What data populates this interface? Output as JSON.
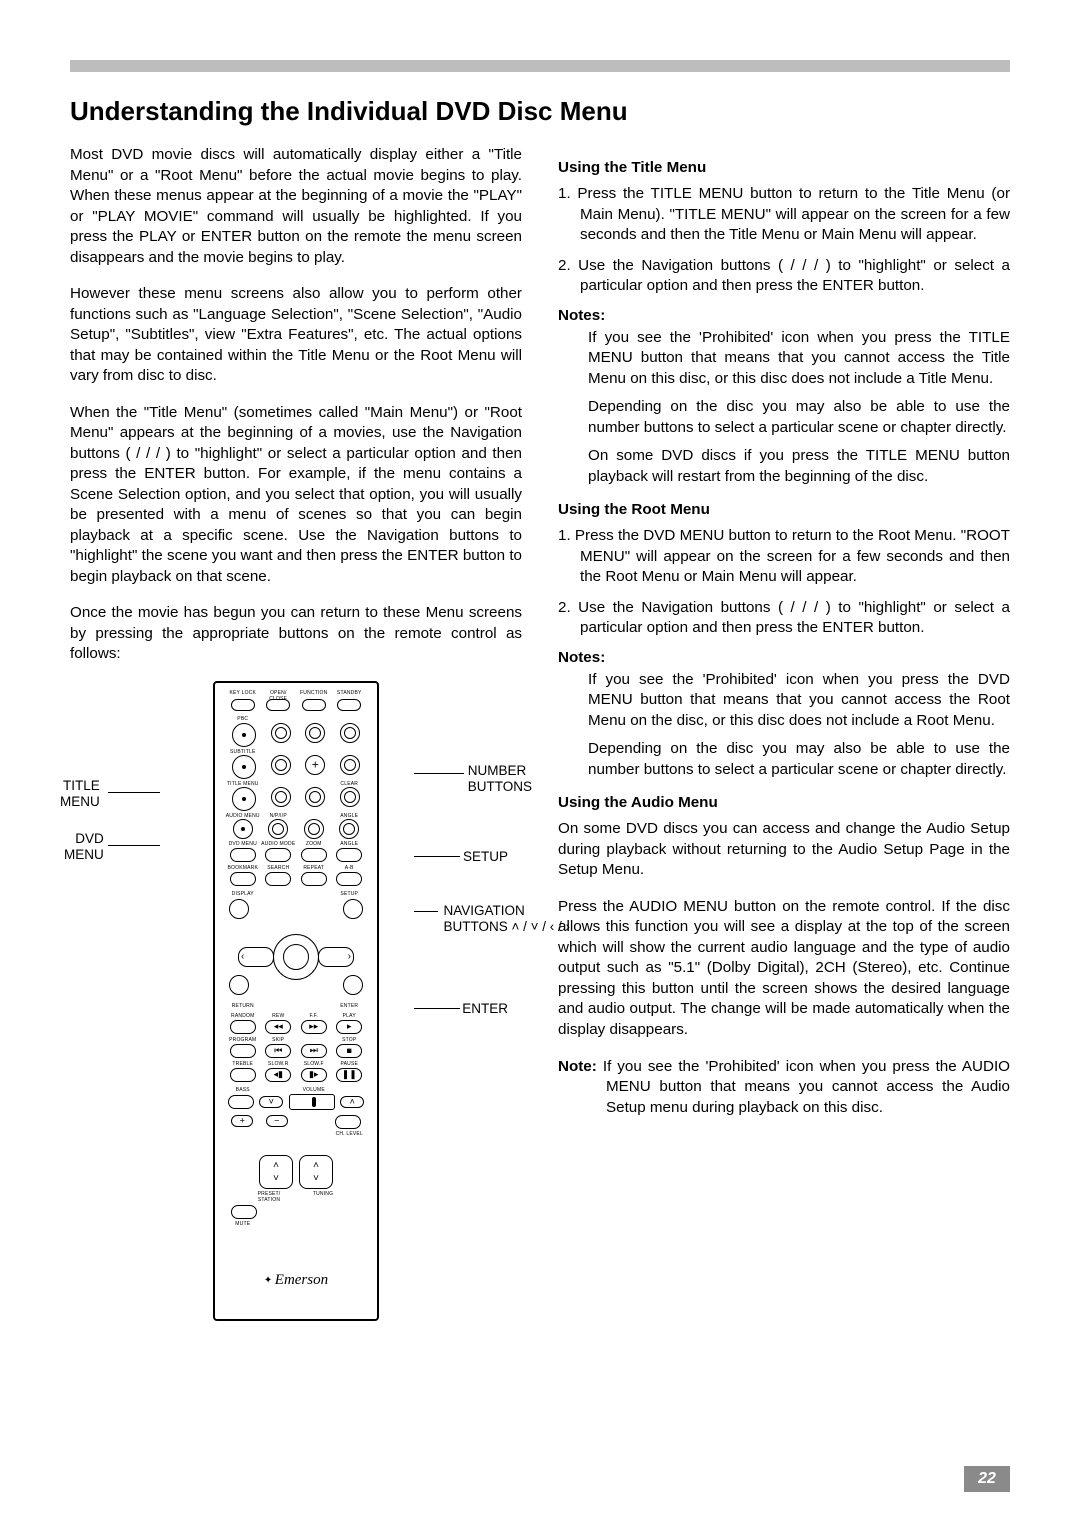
{
  "page_number": "22",
  "title": "Understanding the Individual DVD Disc Menu",
  "left_paras": [
    "Most DVD movie discs will automatically display either a \"Title Menu\" or a \"Root Menu\" before the actual movie begins to play. When these menus appear at the beginning of a movie the \"PLAY\" or \"PLAY MOVIE\" command will usually be highlighted. If you press the PLAY or ENTER button on the remote the menu screen disappears and the movie begins to play.",
    "However these menu screens also allow you to perform other functions such as \"Language Selection\", \"Scene Selection\", \"Audio Setup\", \"Subtitles\", view \"Extra Features\", etc. The actual options that may be contained within the Title Menu or the Root Menu will vary from disc to disc.",
    "When the \"Title Menu\" (sometimes called \"Main Menu\") or \"Root Menu\" appears at the beginning of a movies, use the Navigation buttons (    /    /    /    ) to \"highlight\" or select a particular option and then press the ENTER button. For example, if the menu contains a Scene Selection option, and you select that option, you will usually be presented with a menu of scenes so that you can begin playback at a specific scene. Use the Navigation buttons to \"highlight\" the scene you want and then press the ENTER button to begin playback on that scene.",
    "Once the movie has begun you can return to these Menu screens by pressing the appropriate buttons on the remote control as follows:"
  ],
  "sections": [
    {
      "heading": "Using the Title Menu",
      "items": [
        "1. Press the TITLE MENU button to return to the Title Menu (or Main Menu). \"TITLE MENU\" will appear on the screen for a few seconds and then the Title Menu or Main Menu will appear.",
        "2. Use the Navigation buttons (    /    /    /    ) to \"highlight\" or select a particular option and then press the ENTER button."
      ],
      "notes_label": "Notes:",
      "notes": [
        "If you see the 'Prohibited' icon when you press the TITLE MENU button that means that you cannot access the Title Menu on this disc, or this disc does not include a Title Menu.",
        "Depending on the disc you may also be able to use the number buttons to select a particular scene or chapter directly.",
        "On some DVD discs if you press the TITLE MENU button playback will restart from the beginning of the disc."
      ]
    },
    {
      "heading": "Using the Root Menu",
      "items": [
        "1. Press the DVD MENU button to return to the Root Menu. \"ROOT MENU\" will appear on the screen for a few seconds and then the Root Menu or Main Menu will appear.",
        "2. Use the Navigation buttons (    /    /    /    ) to \"highlight\" or select a particular option and then press the ENTER button."
      ],
      "notes_label": "Notes:",
      "notes": [
        "If you see the 'Prohibited' icon when you press the DVD MENU button that means that you cannot access the Root Menu on the disc, or this disc does not include a Root Menu.",
        "Depending on the disc you may also be able to use the number buttons to select a particular scene or chapter directly."
      ]
    },
    {
      "heading": "Using the Audio Menu",
      "paras": [
        "On some DVD discs you can access and change the Audio Setup during playback without returning to the Audio Setup Page in the Setup Menu.",
        "Press the AUDIO MENU button on the remote control. If the disc allows this function you will see a display at the top of the screen which will show the current audio language and the type of audio output such as \"5.1\" (Dolby Digital), 2CH (Stereo), etc. Continue pressing this button until the screen shows the desired language and audio output. The change will be made automatically when the display disappears."
      ],
      "note_inline_label": "Note:",
      "note_inline": "If you see the 'Prohibited' icon when you press the AUDIO MENU button that means you cannot access the Audio Setup menu during playback on this disc."
    }
  ],
  "remote": {
    "brand": "Emerson",
    "row_labels": {
      "r1": [
        "KEY LOCK",
        "OPEN/\nCLOSE",
        "FUNCTION",
        "STANDBY"
      ],
      "r2": [
        "PBC",
        "",
        "",
        ""
      ],
      "r3": [
        "SUBTITLE",
        "",
        "",
        ""
      ],
      "r4": [
        "TITLE MENU",
        "",
        "",
        "CLEAR"
      ],
      "r5": [
        "AUDIO MENU",
        "N/P/I/P",
        "ZOOM",
        "ANGLE"
      ],
      "r6": [
        "DVD MENU",
        "AUDIO MODE",
        "",
        ""
      ],
      "r7": [
        "BOOKMARK",
        "SEARCH",
        "REPEAT",
        "A-B"
      ],
      "disp": [
        "DISPLAY",
        "",
        "",
        "SETUP"
      ],
      "re": [
        "RETURN",
        "",
        "",
        "ENTER"
      ],
      "r8": [
        "RANDOM",
        "REW",
        "F.F.",
        "PLAY"
      ],
      "r9": [
        "PROGRAM",
        "SKIP",
        "",
        "STOP"
      ],
      "r10": [
        "TREBLE",
        "SLOW.R",
        "SLOW.F",
        "PAUSE"
      ],
      "r11": [
        "BASS",
        "",
        "VOLUME",
        ""
      ],
      "r12": [
        "+",
        "-",
        "",
        "CH. LEVEL"
      ],
      "r13": [
        "",
        "PRESET/\nSTATION",
        "",
        "TUNING"
      ],
      "r14": [
        "MUTE",
        "",
        "",
        ""
      ]
    },
    "annotations": {
      "title_menu": "TITLE\nMENU",
      "dvd_menu": "DVD\nMENU",
      "number_buttons": "NUMBER\nBUTTONS",
      "setup": "SETUP",
      "nav": "NAVIGATION\nBUTTONS ˄ / ˅ / ‹ / ›",
      "enter": "ENTER"
    }
  }
}
